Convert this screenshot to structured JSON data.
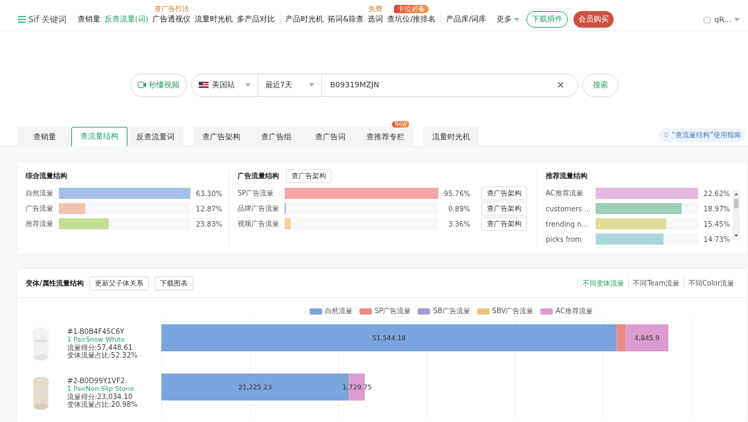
{
  "nav": {
    "logo": "Sif 关键词",
    "groups": [
      [
        {
          "label": "查销量",
          "selected": false
        },
        {
          "label": "反查流量(词)",
          "selected": true
        },
        {
          "label": "广告透视仪",
          "selected": false,
          "tag": {
            "text": "查广告打法",
            "kind": "plain"
          }
        },
        {
          "label": "流量时光机",
          "selected": false
        },
        {
          "label": "多产品对比",
          "selected": false
        }
      ],
      [
        {
          "label": "产品时光机",
          "selected": false
        },
        {
          "label": "拓词&筛查",
          "selected": false
        },
        {
          "label": "选词",
          "selected": false,
          "tag": {
            "text": "免费",
            "kind": "plain"
          }
        },
        {
          "label": "查坑位/推排名",
          "selected": false,
          "tag": {
            "text": "卡位必备",
            "kind": "flame"
          }
        }
      ],
      [
        {
          "label": "产品库/词库",
          "selected": false
        }
      ]
    ],
    "more": "更多",
    "download": "下载插件",
    "buy": "会员购买",
    "user": "qR..."
  },
  "search": {
    "video_button": "秒懂视频",
    "site": "美国站",
    "range": "最近7天",
    "value": "B09319MZJN",
    "submit": "搜索"
  },
  "tabs": [
    [
      {
        "label": "查销量",
        "selected": false
      },
      {
        "label": "查流量结构",
        "selected": true
      },
      {
        "label": "反查流量词",
        "selected": false
      }
    ],
    [
      {
        "label": "查广告架构",
        "selected": false
      },
      {
        "label": "查广告组",
        "selected": false
      },
      {
        "label": "查广告词",
        "selected": false
      },
      {
        "label": "查推荐专栏",
        "selected": false,
        "badge": "New"
      }
    ],
    [
      {
        "label": "流量时光机",
        "selected": false
      }
    ]
  ],
  "guide": "“查流量结构”使用指南",
  "structure": [
    {
      "title": "综合流量结构",
      "rows": [
        {
          "name": "自然流量",
          "level": 1,
          "value": "63.30%",
          "color": "#a3c0e6"
        },
        {
          "name": "广告流量",
          "level": 0.2,
          "value": "12.87%",
          "color": "#f3c2b3"
        },
        {
          "name": "推荐流量",
          "level": 0.38,
          "value": "23.83%",
          "color": "#c2de95"
        }
      ]
    },
    {
      "title": "广告流量结构",
      "action": "查广告架构",
      "rows": [
        {
          "name": "SP广告流量",
          "level": 1,
          "value": "95.76%",
          "color": "#f2a6a6",
          "action": "查广告架构"
        },
        {
          "name": "品牌广告流量",
          "level": 0.01,
          "value": "0.89%",
          "color": "#b3b3da",
          "action": "查广告架构"
        },
        {
          "name": "视频广告流量",
          "level": 0.04,
          "value": "3.36%",
          "color": "#eed39a",
          "action": "查广告架构"
        }
      ]
    },
    {
      "title": "推荐流量结构",
      "rows": [
        {
          "name": "AC推荐流量",
          "level": 1,
          "value": "22.62%",
          "color": "#e6b8de"
        },
        {
          "name": "customers ...",
          "level": 0.84,
          "value": "18.97%",
          "color": "#9bcfb8"
        },
        {
          "name": "trending n...",
          "level": 0.69,
          "value": "15.45%",
          "color": "#dedc98"
        },
        {
          "name": "picks from",
          "level": 0.66,
          "value": "14.73%",
          "color": "#a8d8dc"
        }
      ]
    }
  ],
  "variants": {
    "title": "变体/属性流量结构",
    "buttons": [
      "更新父子体关系",
      "下载图表"
    ],
    "views": [
      {
        "label": "不同变体流量",
        "selected": true
      },
      {
        "label": "不同Team流量",
        "selected": false
      },
      {
        "label": "不同Color流量",
        "selected": false
      }
    ],
    "items": [
      {
        "id": "#1-B0B4F45C6Y",
        "name": "1 PairSnow White",
        "score": "流量得分:57,448.61",
        "share": "变体流量占比:52.32%"
      },
      {
        "id": "#2-B0D99Y1VF2",
        "name": "1 PairNon Slip Stone",
        "score": "流量得分:23,034.10",
        "share": "变体流量占比:20.98%"
      }
    ],
    "chart_data": {
      "type": "bar",
      "orientation": "horizontal",
      "stacked": true,
      "legend": "top",
      "series": [
        {
          "name": "自然流量",
          "color": "#7aa5dc",
          "values": [
            51544.18,
            21225.23
          ],
          "value_labels": [
            "51,544.18",
            "21,225.23"
          ]
        },
        {
          "name": "SP广告流量",
          "color": "#ec8a85",
          "values": [
            1025.36,
            79.12
          ],
          "value_labels": [
            null,
            null
          ]
        },
        {
          "name": "SB广告流量",
          "color": "#a49ad6",
          "values": [
            null,
            null
          ],
          "value_labels": [
            null,
            null
          ]
        },
        {
          "name": "SBV广告流量",
          "color": "#e9c57c",
          "values": [
            null,
            null
          ],
          "value_labels": [
            null,
            null
          ]
        },
        {
          "name": "AC推荐流量",
          "color": "#dc9cd0",
          "values": [
            4845.9,
            1729.75
          ],
          "value_labels": [
            "4,845.9",
            "1,729.75"
          ]
        }
      ]
    }
  }
}
